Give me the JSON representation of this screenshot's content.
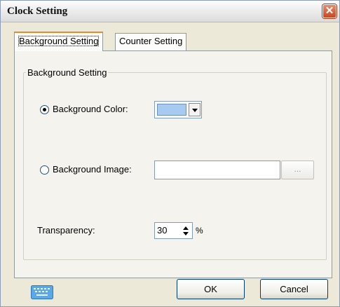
{
  "window": {
    "title": "Clock Setting",
    "close_glyph": "✕"
  },
  "tabs": [
    {
      "label": "Background Setting",
      "active": true
    },
    {
      "label": "Counter Setting",
      "active": false
    }
  ],
  "background_group": {
    "legend": "Background Setting",
    "color_option": {
      "label": "Background Color:",
      "selected": true,
      "swatch_color": "#a6caf0"
    },
    "image_option": {
      "label": "Background Image:",
      "selected": false,
      "value": "",
      "browse_label": "..."
    }
  },
  "transparency": {
    "label": "Transparency:",
    "value": "30",
    "unit": "%"
  },
  "buttons": {
    "ok": "OK",
    "cancel": "Cancel"
  },
  "icons": {
    "keyboard": "keyboard-icon",
    "close": "close-icon"
  },
  "colors": {
    "tab_highlight": "#e68b2c",
    "dialog_bg": "#ece9d8",
    "panel_bg": "#f4f3ee",
    "close_red": "#c8461f"
  }
}
